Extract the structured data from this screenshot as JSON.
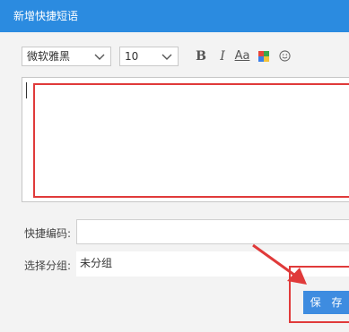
{
  "dialog": {
    "title": "新增快捷短语"
  },
  "toolbar": {
    "font_family": "微软雅黑",
    "font_size": "10",
    "bold": "B",
    "italic": "I",
    "font_style": "Aa",
    "color_icon": "color-palette-icon",
    "emoji_icon": "smiley-icon"
  },
  "form": {
    "shortcut_label": "快捷编码:",
    "shortcut_value": "",
    "group_label": "选择分组:",
    "group_value": "未分组"
  },
  "actions": {
    "save_label": "保 存"
  },
  "colors": {
    "titlebar": "#2b8be0",
    "save_button": "#3e8ce0",
    "highlight": "#e03a3a"
  }
}
